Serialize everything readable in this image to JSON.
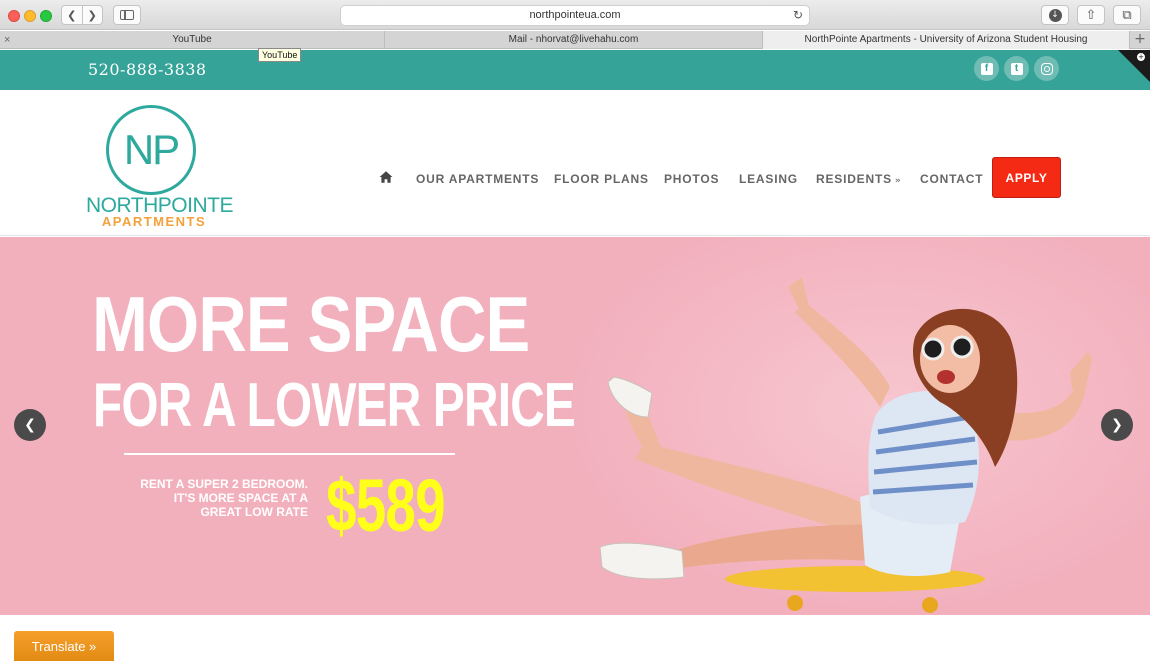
{
  "browser": {
    "url": "northpointeua.com",
    "tabs": [
      {
        "label": "YouTube"
      },
      {
        "label": "Mail - nhorvat@livehahu.com"
      },
      {
        "label": "NorthPointe Apartments - University of Arizona Student Housing"
      }
    ],
    "tooltip": "YouTube"
  },
  "topbar": {
    "phone": "520-888-3838",
    "social": [
      "facebook-icon",
      "twitter-icon",
      "instagram-icon"
    ]
  },
  "logo": {
    "mark": "NP",
    "name": "NORTHPOINTE",
    "sub": "APARTMENTS"
  },
  "nav": {
    "items": [
      {
        "label": "OUR APARTMENTS"
      },
      {
        "label": "FLOOR PLANS"
      },
      {
        "label": "PHOTOS"
      },
      {
        "label": "LEASING"
      },
      {
        "label": "RESIDENTS"
      },
      {
        "label": "CONTACT"
      }
    ],
    "apply": "APPLY"
  },
  "hero": {
    "headline_1": "MORE SPACE",
    "headline_2": "FOR A LOWER PRICE",
    "promo_lines": [
      "RENT A SUPER 2 BEDROOM.",
      "IT'S MORE SPACE AT A",
      "GREAT LOW RATE"
    ],
    "price": "$589"
  },
  "translate": {
    "label": "Translate »"
  },
  "colors": {
    "teal": "#36a398",
    "apply_red": "#f52a14",
    "hero_pink": "#f2b0bd",
    "price_yellow": "#ffff1a",
    "translate_orange": "#f6a02c"
  }
}
